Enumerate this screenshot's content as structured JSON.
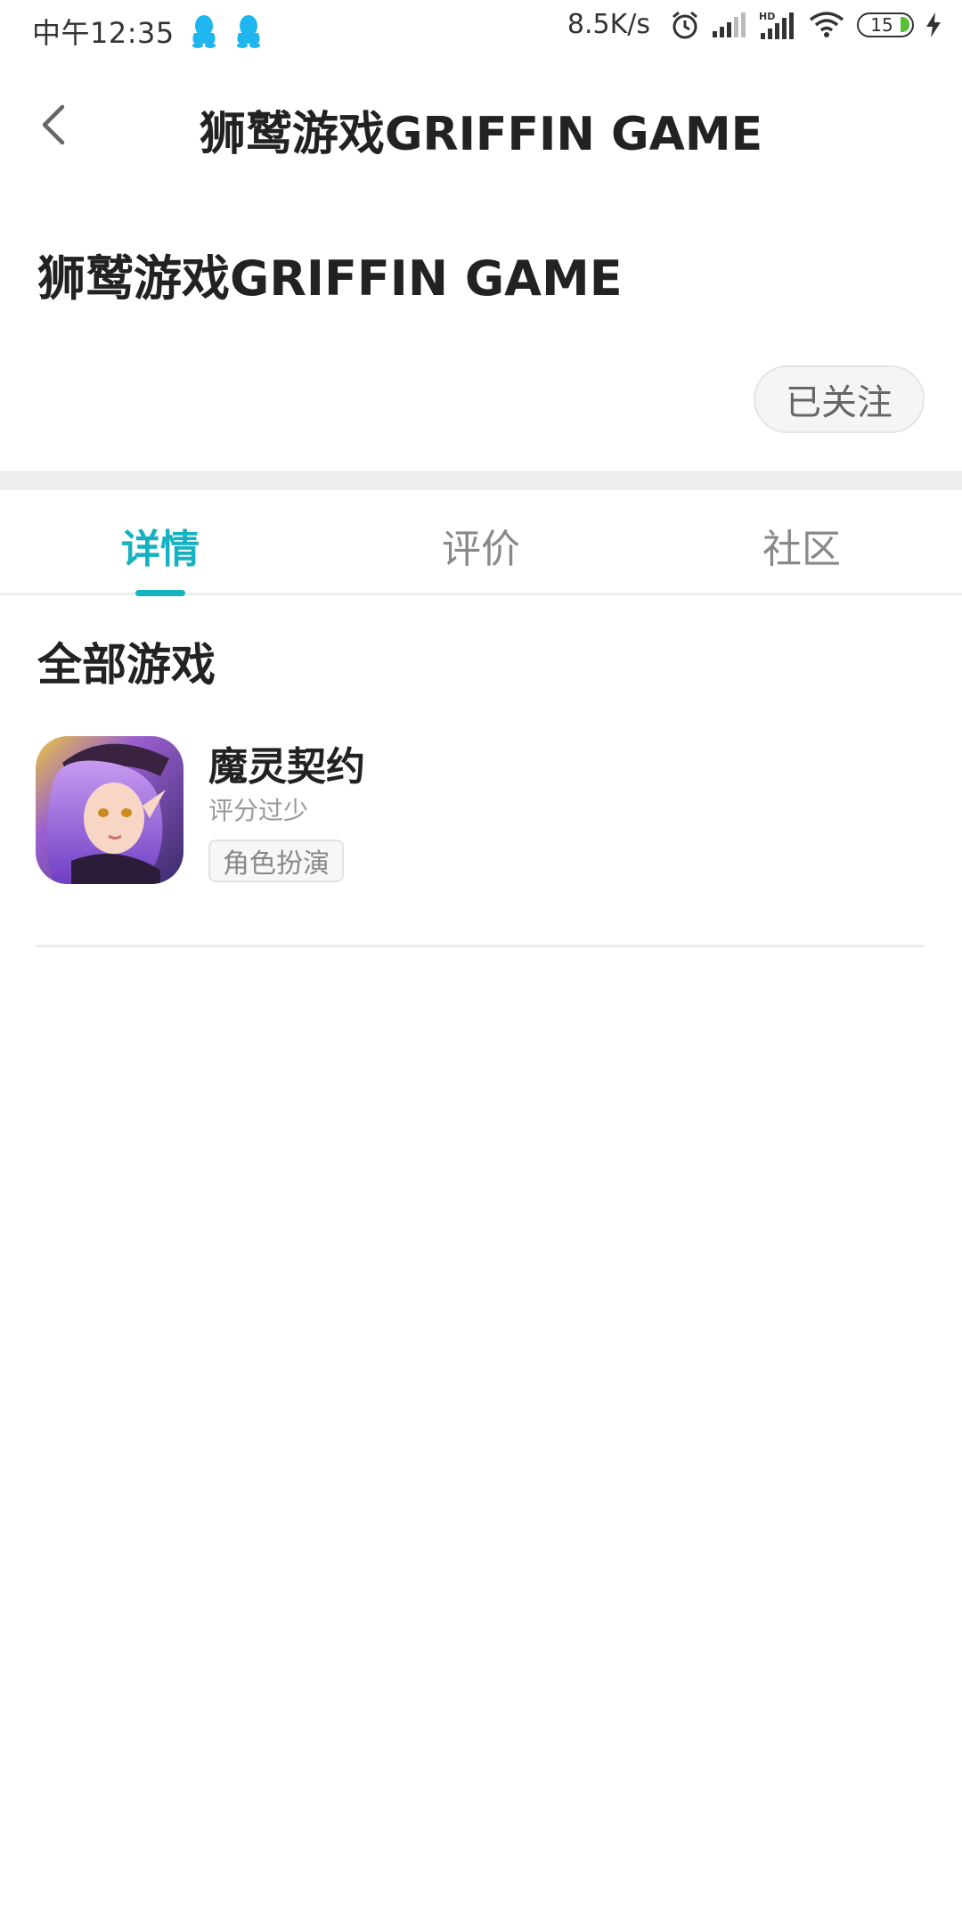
{
  "status_bar": {
    "time": "中午12:35",
    "net_speed": "8.5K/s",
    "battery": "15",
    "network_label": "HD"
  },
  "header": {
    "title": "狮鹫游戏GRIFFIN GAME"
  },
  "publisher": {
    "name": "狮鹫游戏GRIFFIN GAME",
    "follow_label": "已关注"
  },
  "tabs": [
    {
      "label": "详情",
      "active": true
    },
    {
      "label": "评价",
      "active": false
    },
    {
      "label": "社区",
      "active": false
    }
  ],
  "games": {
    "section_title": "全部游戏",
    "items": [
      {
        "name": "魔灵契约",
        "rating": "评分过少",
        "tag": "角色扮演"
      }
    ]
  },
  "colors": {
    "accent": "#17b2c2",
    "qq_blue": "#1fb6f0",
    "battery_green": "#57c135"
  },
  "icons": [
    "back-arrow-icon",
    "qq-icon",
    "alarm-icon",
    "signal-icon",
    "wifi-icon",
    "battery-icon",
    "charging-icon"
  ]
}
